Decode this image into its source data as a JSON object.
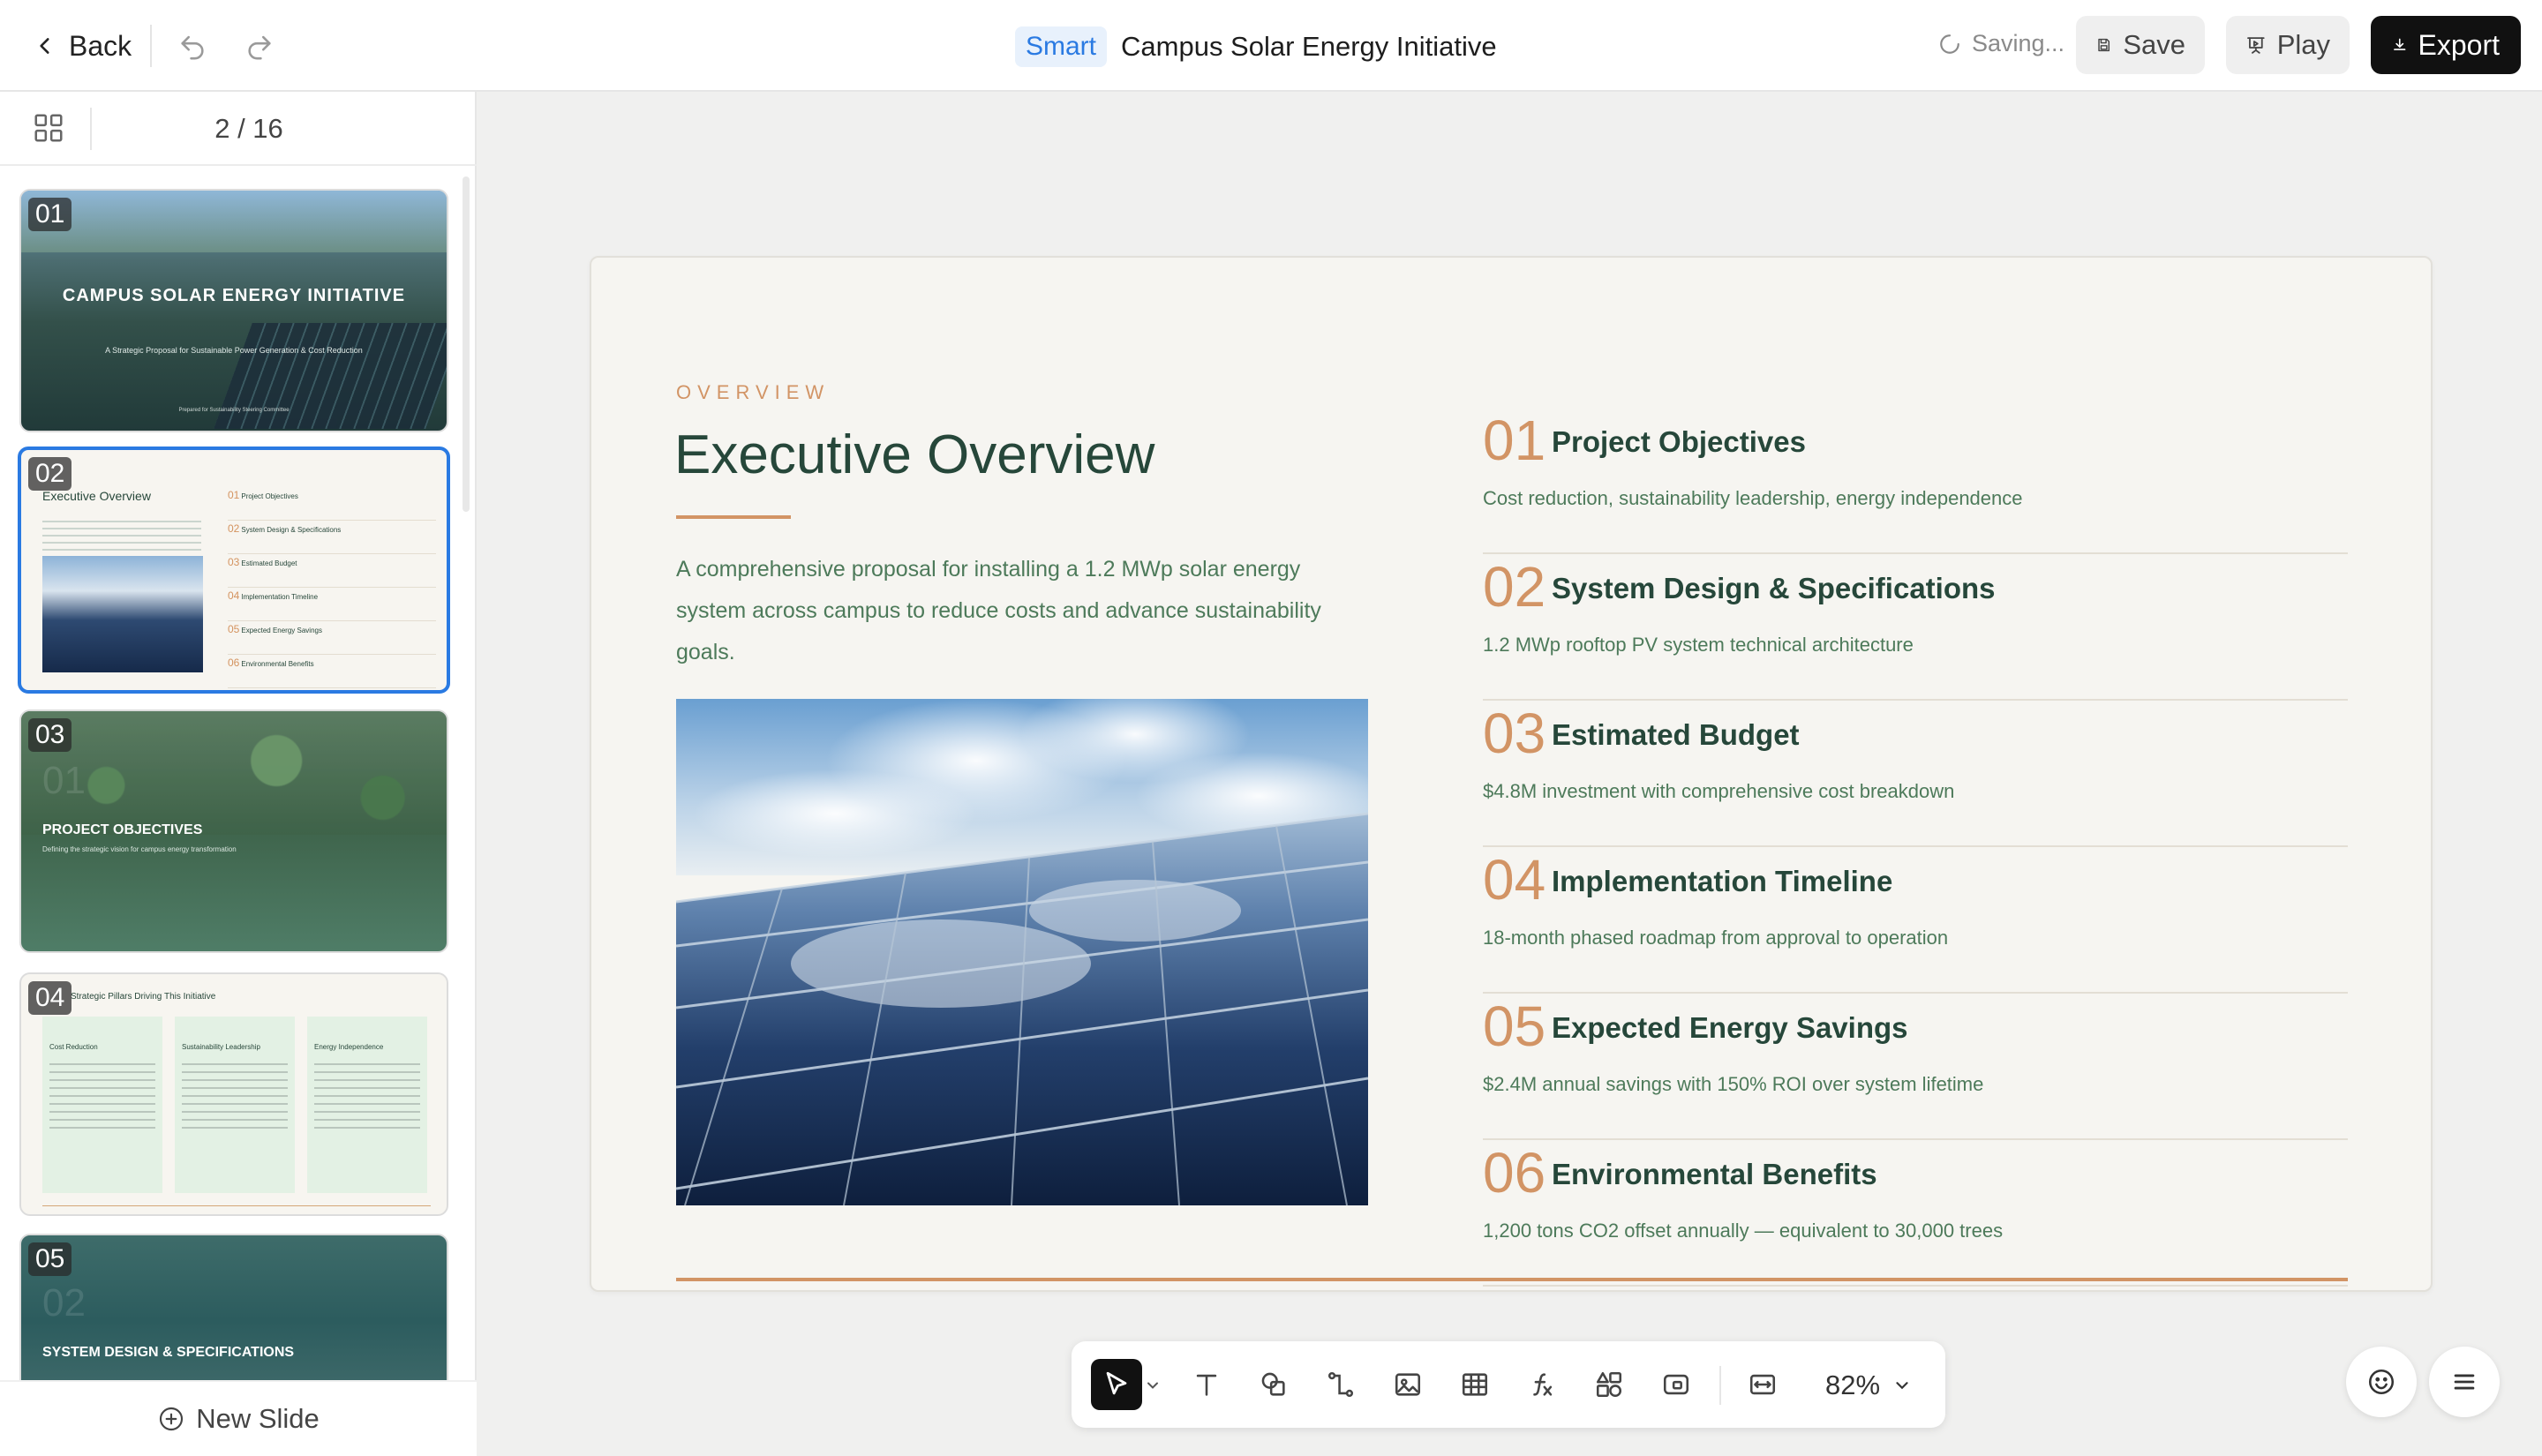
{
  "topbar": {
    "back_label": "Back",
    "badge": "Smart",
    "title": "Campus Solar Energy Initiative",
    "saving_label": "Saving...",
    "save_label": "Save",
    "play_label": "Play",
    "export_label": "Export"
  },
  "sidebar": {
    "page_counter": "2 / 16",
    "new_slide_label": "New Slide",
    "thumbnails": [
      {
        "num": "01",
        "title": "CAMPUS SOLAR ENERGY INITIATIVE",
        "subtitle": "A Strategic Proposal for Sustainable Power Generation & Cost Reduction",
        "footer": "Prepared for Sustainability Steering Committee"
      },
      {
        "num": "02",
        "title": "Executive Overview",
        "items": [
          "Project Objectives",
          "System Design & Specifications",
          "Estimated Budget",
          "Implementation Timeline",
          "Expected Energy Savings",
          "Environmental Benefits"
        ]
      },
      {
        "num": "03",
        "ghost": "01",
        "title": "PROJECT OBJECTIVES",
        "subtitle": "Defining the strategic vision for campus energy transformation"
      },
      {
        "num": "04",
        "title": "Strategic Pillars Driving This Initiative",
        "columns": [
          "Cost Reduction",
          "Sustainability Leadership",
          "Energy Independence"
        ]
      },
      {
        "num": "05",
        "ghost": "02",
        "title": "SYSTEM DESIGN & SPECIFICATIONS"
      }
    ]
  },
  "slide": {
    "overline": "OVERVIEW",
    "title": "Executive Overview",
    "description": "A comprehensive proposal for installing a 1.2 MWp solar energy system across campus to reduce costs and advance sustainability goals.",
    "items": [
      {
        "num": "01",
        "title": "Project Objectives",
        "desc": "Cost reduction, sustainability leadership, energy independence"
      },
      {
        "num": "02",
        "title": "System Design & Specifications",
        "desc": "1.2 MWp rooftop PV system technical architecture"
      },
      {
        "num": "03",
        "title": "Estimated Budget",
        "desc": "$4.8M investment with comprehensive cost breakdown"
      },
      {
        "num": "04",
        "title": "Implementation Timeline",
        "desc": "18-month phased roadmap from approval to operation"
      },
      {
        "num": "05",
        "title": "Expected Energy Savings",
        "desc": "$2.4M annual savings with 150% ROI over system lifetime"
      },
      {
        "num": "06",
        "title": "Environmental Benefits",
        "desc": "1,200 tons CO2 offset annually — equivalent to 30,000 trees"
      }
    ]
  },
  "toolbar": {
    "zoom": "82%",
    "tools": [
      "select-tool",
      "text-tool",
      "shape-tool",
      "connector-tool",
      "image-tool",
      "table-tool",
      "formula-tool",
      "component-tool",
      "media-tool",
      "fit-tool"
    ]
  },
  "colors": {
    "accent": "#d29465",
    "heading": "#26473a",
    "body_text": "#4d7a5a",
    "active_border": "#2a7ae2",
    "export_bg": "#111111"
  }
}
